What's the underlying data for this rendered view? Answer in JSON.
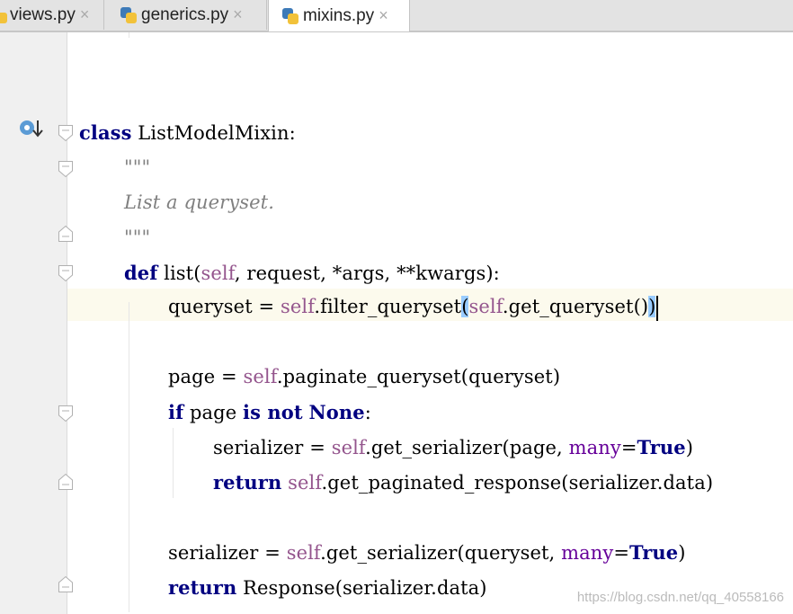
{
  "tabs": [
    {
      "label": "views.py",
      "close": "×",
      "active": false
    },
    {
      "label": "generics.py",
      "close": "×",
      "active": false
    },
    {
      "label": "mixins.py",
      "close": "×",
      "active": true
    }
  ],
  "code": {
    "l1": {
      "kw": "class",
      "name": " ListModelMixin:"
    },
    "l2": {
      "doc": "\"\"\""
    },
    "l3": {
      "doc": "List a queryset."
    },
    "l4": {
      "doc": "\"\"\""
    },
    "l5": {
      "kw": "def",
      "a": " list(",
      "self": "self",
      "b": ", request, *args, **kwargs):"
    },
    "l6": {
      "a": "queryset = ",
      "self1": "self",
      "b": ".filter_queryset",
      "p1": "(",
      "self2": "self",
      "c": ".get_queryset()",
      "p2": ")"
    },
    "l7": {
      "a": "page = ",
      "self": "self",
      "b": ".paginate_queryset(queryset)"
    },
    "l8": {
      "kw1": "if",
      "a": " page ",
      "kw2": "is not",
      "b": " ",
      "kw3": "None",
      "c": ":"
    },
    "l9": {
      "a": "serializer = ",
      "self": "self",
      "b": ".get_serializer(page, ",
      "param": "many",
      "c": "=",
      "kw": "True",
      "d": ")"
    },
    "l10": {
      "kw": "return",
      "b": " ",
      "self": "self",
      "c": ".get_paginated_response(serializer.data)"
    },
    "l11": {
      "a": "serializer = ",
      "self": "self",
      "b": ".get_serializer(queryset, ",
      "param": "many",
      "c": "=",
      "kw": "True",
      "d": ")"
    },
    "l12": {
      "kw": "return",
      "b": " Response(serializer.data)"
    }
  },
  "watermark": "https://blog.csdn.net/qq_40558166",
  "colors": {
    "keyword": "#000080",
    "self": "#94558d",
    "param": "#660099",
    "docstring": "#808080",
    "brace_match": "#99ccff",
    "caret_row": "#fcfaed"
  }
}
